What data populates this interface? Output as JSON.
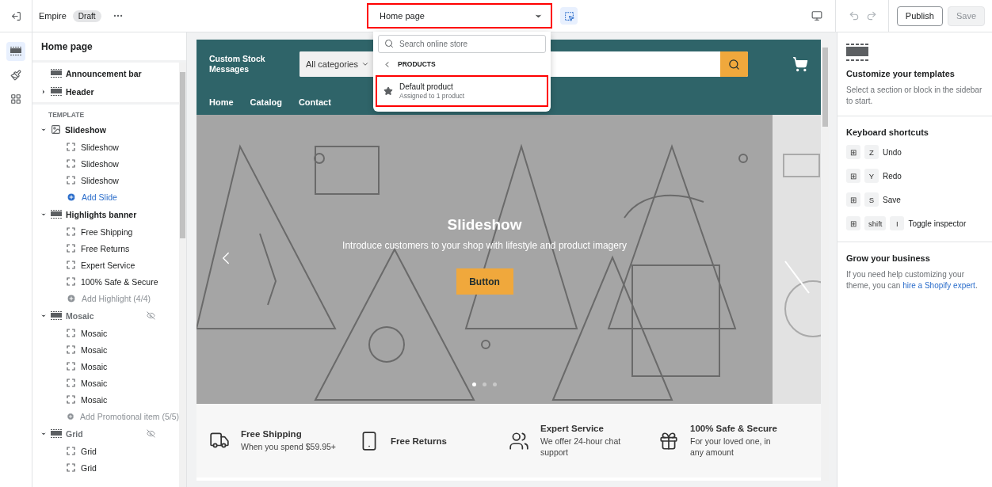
{
  "topbar": {
    "theme_name": "Empire",
    "badge": "Draft",
    "page_select": {
      "value": "Home page",
      "highlighted": true
    },
    "inspector_selected": true,
    "publish": "Publish",
    "save": {
      "label": "Save",
      "disabled": true
    }
  },
  "page_menu": {
    "search": {
      "placeholder": "Search online store"
    },
    "back_label": "PRODUCTS",
    "items": [
      {
        "title": "Default product",
        "subtitle": "Assigned to 1 product",
        "highlighted": true
      }
    ]
  },
  "rail": [
    {
      "kind": "sections",
      "selected": true
    },
    {
      "kind": "theme",
      "selected": false
    },
    {
      "kind": "apps",
      "selected": false
    }
  ],
  "sidebar": {
    "title": "Home page",
    "header_sections": [
      {
        "label": "Announcement bar"
      },
      {
        "label": "Header",
        "expanded": false
      }
    ],
    "group_label": "TEMPLATE",
    "sections": [
      {
        "label": "Slideshow",
        "expanded": true,
        "hidden": false,
        "children": [
          {
            "label": "Slideshow",
            "kind": "block"
          },
          {
            "label": "Slideshow",
            "kind": "block"
          },
          {
            "label": "Slideshow",
            "kind": "block"
          },
          {
            "label": "Add Slide",
            "kind": "add",
            "disabled": false
          }
        ]
      },
      {
        "label": "Highlights banner",
        "expanded": true,
        "hidden": false,
        "children": [
          {
            "label": "Free Shipping",
            "kind": "block"
          },
          {
            "label": "Free Returns",
            "kind": "block"
          },
          {
            "label": "Expert Service",
            "kind": "block"
          },
          {
            "label": "100% Safe & Secure",
            "kind": "block"
          },
          {
            "label": "Add Highlight (4/4)",
            "kind": "add",
            "disabled": true
          }
        ]
      },
      {
        "label": "Mosaic",
        "expanded": true,
        "hidden": true,
        "children": [
          {
            "label": "Mosaic",
            "kind": "block"
          },
          {
            "label": "Mosaic",
            "kind": "block"
          },
          {
            "label": "Mosaic",
            "kind": "block"
          },
          {
            "label": "Mosaic",
            "kind": "block"
          },
          {
            "label": "Mosaic",
            "kind": "block"
          },
          {
            "label": "Add Promotional item (5/5)",
            "kind": "add",
            "disabled": true
          }
        ]
      },
      {
        "label": "Grid",
        "expanded": true,
        "hidden": true,
        "children": [
          {
            "label": "Grid",
            "kind": "block"
          },
          {
            "label": "Grid",
            "kind": "block"
          }
        ]
      }
    ]
  },
  "store": {
    "logo": "Custom Stock Messages",
    "category_select": "All categories",
    "nav": [
      "Home",
      "Catalog",
      "Contact"
    ],
    "slideshow": {
      "kind": "picture",
      "heading": "Slideshow",
      "text": "Introduce customers to your shop with lifestyle and product imagery",
      "button": "Button",
      "dots": [
        {
          "selected": true
        },
        {
          "selected": false
        },
        {
          "selected": false
        }
      ]
    },
    "highlights": [
      {
        "title": "Free Shipping",
        "text": "When you spend $59.95+"
      },
      {
        "title": "Free Returns"
      },
      {
        "title": "Expert Service",
        "text": "We offer 24-hour chat support"
      },
      {
        "title": "100% Safe & Secure",
        "text": "For your loved one, in any amount"
      }
    ]
  },
  "inspector": {
    "intro": {
      "title": "Customize your templates",
      "text": "Select a section or block in the sidebar to start."
    },
    "shortcuts": {
      "title": "Keyboard shortcuts",
      "items": [
        {
          "keys": [
            "⊞",
            "Z"
          ],
          "label": "Undo"
        },
        {
          "keys": [
            "⊞",
            "Y"
          ],
          "label": "Redo"
        },
        {
          "keys": [
            "⊞",
            "S"
          ],
          "label": "Save"
        },
        {
          "keys": [
            "⊞",
            "shift",
            "I"
          ],
          "label": "Toggle inspector"
        }
      ]
    },
    "grow": {
      "title": "Grow your business",
      "text": "If you need help customizing your theme, you can",
      "link": "hire a Shopify expert",
      "after": "."
    }
  }
}
